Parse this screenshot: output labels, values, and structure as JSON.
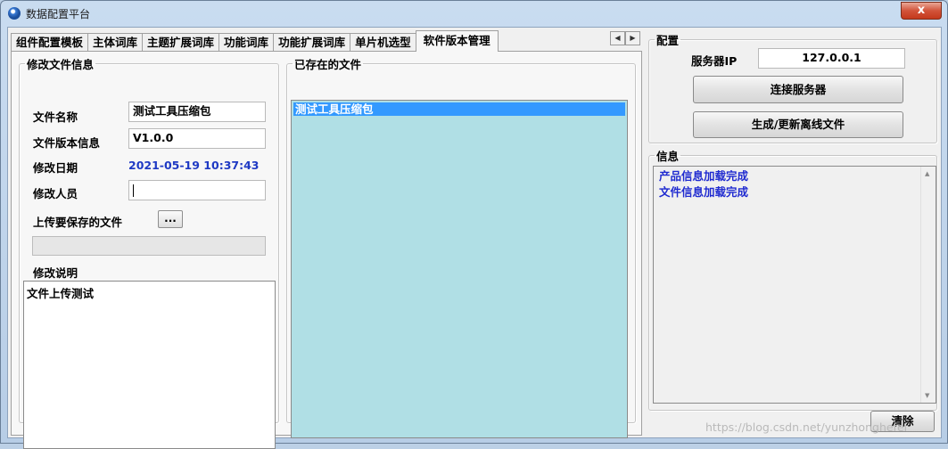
{
  "window": {
    "title": "数据配置平台",
    "close_label": "x"
  },
  "tabs": [
    {
      "label": "组件配置模板"
    },
    {
      "label": "主体词库"
    },
    {
      "label": "主题扩展词库"
    },
    {
      "label": "功能词库"
    },
    {
      "label": "功能扩展词库"
    },
    {
      "label": "单片机选型"
    },
    {
      "label": "软件版本管理",
      "active": true
    }
  ],
  "tab_scroll": {
    "left": "◀",
    "right": "▶"
  },
  "modify_group": {
    "legend": "修改文件信息",
    "file_name_label": "文件名称",
    "file_name_value": "测试工具压缩包",
    "version_label": "文件版本信息",
    "version_value": "V1.0.0",
    "date_label": "修改日期",
    "date_value": "2021-05-19 10:37:43",
    "person_label": "修改人员",
    "person_value": "",
    "upload_label": "上传要保存的文件",
    "browse_label": "...",
    "upload_progress": 0,
    "description_label": "修改说明",
    "description_value": "文件上传测试"
  },
  "existing_group": {
    "legend": "已存在的文件",
    "files": [
      "测试工具压缩包"
    ]
  },
  "config_group": {
    "legend": "配置",
    "server_ip_label": "服务器IP",
    "server_ip_value": "127.0.0.1",
    "connect_label": "连接服务器",
    "generate_label": "生成/更新离线文件"
  },
  "info_group": {
    "legend": "信息",
    "lines": [
      "产品信息加载完成",
      "文件信息加载完成"
    ],
    "clear_label": "清除"
  },
  "watermark": "https://blog.csdn.net/yunzhonghefei",
  "colors": {
    "file_highlight": "#3399ff",
    "file_list_bg": "#b0dfe5",
    "info_text": "#1f2ad0",
    "date_text": "#1f3ac4"
  }
}
